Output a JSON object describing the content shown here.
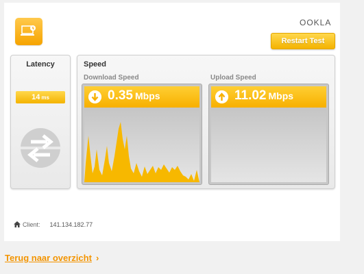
{
  "brand": {
    "logo_text": "OOKLA",
    "accent": "#f6a800"
  },
  "toolbar": {
    "restart_label": "Restart Test"
  },
  "latency": {
    "title": "Latency",
    "value": "14",
    "unit": "ms"
  },
  "speed": {
    "title": "Speed",
    "download": {
      "label": "Download Speed",
      "value": "0.35",
      "unit": "Mbps"
    },
    "upload": {
      "label": "Upload Speed",
      "value": "11.02",
      "unit": "Mbps"
    }
  },
  "client": {
    "label": "Client:",
    "ip": "141.134.182.77"
  },
  "footer": {
    "back_link": "Terug naar overzicht",
    "chevron": "›"
  }
}
